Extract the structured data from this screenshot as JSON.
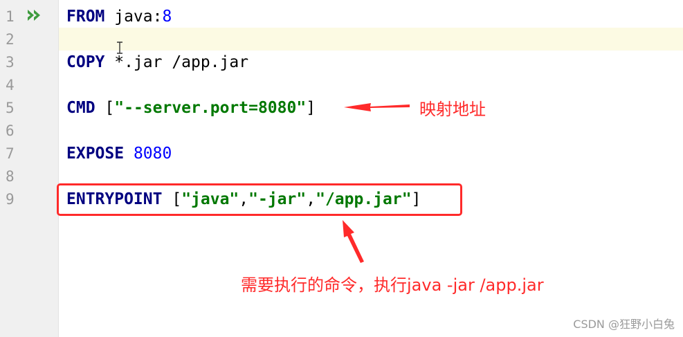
{
  "editor": {
    "line_numbers": [
      "1",
      "2",
      "3",
      "4",
      "5",
      "6",
      "7",
      "8",
      "9"
    ],
    "lines": {
      "line1": {
        "keyword": "FROM",
        "text": " java:",
        "number": "8"
      },
      "line3": {
        "keyword": "COPY",
        "text": " *.jar /app.jar"
      },
      "line5": {
        "keyword": "CMD",
        "open": " [",
        "string": "\"--server.port=8080\"",
        "close": "]"
      },
      "line7": {
        "keyword": "EXPOSE",
        "number": " 8080"
      },
      "line9": {
        "keyword": "ENTRYPOINT",
        "open": " [",
        "s1": "\"java\"",
        "c1": ",",
        "s2": "\"-jar\"",
        "c2": ",",
        "s3": "\"/app.jar\"",
        "close": "]"
      }
    },
    "run_icon": "run-double-chevron-icon"
  },
  "annotations": {
    "mapping": "映射地址",
    "command": "需要执行的命令，执行java -jar /app.jar"
  },
  "watermark": "CSDN @狂野小白兔",
  "colors": {
    "keyword": "#000080",
    "number": "#0000ff",
    "string": "#007800",
    "annotation": "#ff2a2a",
    "gutter": "#f0f0f0",
    "current_line": "#fcfae3"
  }
}
